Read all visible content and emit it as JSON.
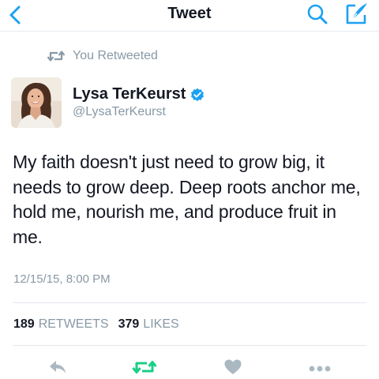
{
  "nav": {
    "title": "Tweet",
    "back_icon": "chevron-left-icon",
    "search_icon": "search-icon",
    "compose_icon": "compose-icon"
  },
  "retweet_context": {
    "text": "You Retweeted",
    "icon": "retweet-icon"
  },
  "author": {
    "name": "Lysa TerKeurst",
    "handle": "@LysaTerKeurst",
    "verified": true,
    "verified_icon": "verified-badge-icon"
  },
  "tweet": {
    "text": "My faith doesn't just need to grow big, it needs to grow deep. Deep roots anchor me, hold me, nourish me, and produce fruit in me.",
    "timestamp": "12/15/15, 8:00 PM"
  },
  "stats": {
    "retweets_count": "189",
    "retweets_label": "RETWEETS",
    "likes_count": "379",
    "likes_label": "LIKES"
  },
  "actions": {
    "reply_icon": "reply-icon",
    "retweet_icon": "retweet-icon",
    "like_icon": "heart-icon",
    "more_icon": "more-icon"
  },
  "colors": {
    "accent": "#1da1f2",
    "retweeted": "#19cf86",
    "muted": "#8899a6",
    "icon_gray": "#aab8c2",
    "text": "#141823",
    "divider": "#e1e8ed"
  }
}
